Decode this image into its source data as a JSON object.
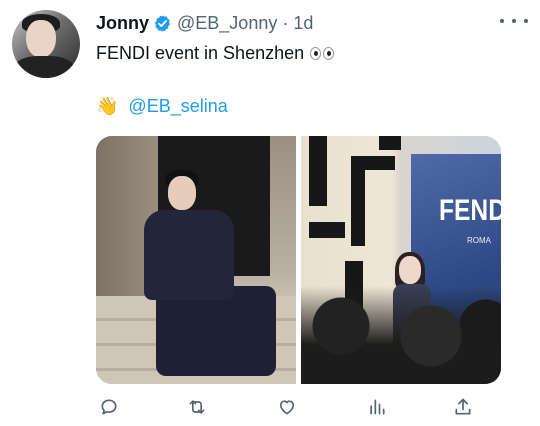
{
  "tweet": {
    "author": {
      "name": "Jonny",
      "handle": "@EB_Jonny",
      "separator": "·",
      "time": "1d",
      "verified": true,
      "avatar_icon": "avatar"
    },
    "text": "FENDI event in Shenzhen",
    "text_emoji": "eyes",
    "mention_emoji": "👋",
    "mention": "@EB_selina",
    "media": [
      {
        "type": "photo",
        "overlay_text": ""
      },
      {
        "type": "photo",
        "overlay_text": "FEND",
        "sub_text": "ROMA"
      }
    ],
    "actions": [
      "reply-icon",
      "retweet-icon",
      "like-icon",
      "analytics-icon",
      "share-icon"
    ],
    "colors": {
      "accent": "#1d9bf0",
      "text": "#0f1419",
      "muted": "#536471"
    }
  }
}
